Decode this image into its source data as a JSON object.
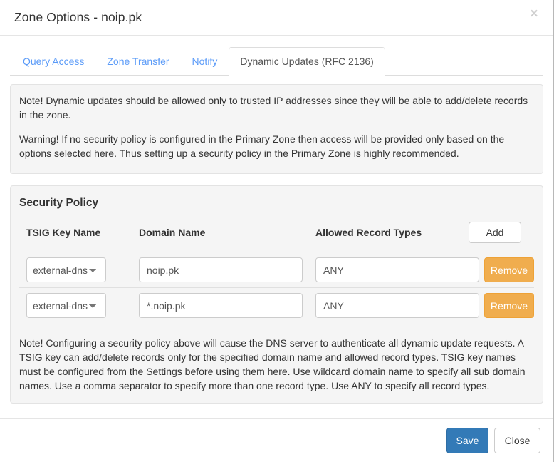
{
  "modal": {
    "title": "Zone Options - noip.pk",
    "close_icon": "close-icon",
    "close_symbol": "×"
  },
  "tabs": [
    {
      "label": "Query Access",
      "active": false
    },
    {
      "label": "Zone Transfer",
      "active": false
    },
    {
      "label": "Notify",
      "active": false
    },
    {
      "label": "Dynamic Updates (RFC 2136)",
      "active": true
    }
  ],
  "notes_top": [
    "Note! Dynamic updates should be allowed only to trusted IP addresses since they will be able to add/delete records in the zone.",
    "Warning! If no security policy is configured in the Primary Zone then access will be provided only based on the options selected here. Thus setting up a security policy in the Primary Zone is highly recommended."
  ],
  "security_policy": {
    "heading": "Security Policy",
    "columns": {
      "tsig_key_name": "TSIG Key Name",
      "domain_name": "Domain Name",
      "allowed_record_types": "Allowed Record Types"
    },
    "add_label": "Add",
    "remove_label": "Remove",
    "rows": [
      {
        "tsig_key": "external-dns",
        "tsig_options": [
          "external-dns"
        ],
        "domain": "noip.pk",
        "domain_placeholder": "",
        "types": "ANY",
        "types_placeholder": "",
        "remove_label": "Remove"
      },
      {
        "tsig_key": "external-dns",
        "tsig_options": [
          "external-dns"
        ],
        "domain": "*.noip.pk",
        "domain_placeholder": "",
        "types": "ANY",
        "types_placeholder": "",
        "remove_label": "Remove"
      }
    ],
    "footer_note": "Note! Configuring a security policy above will cause the DNS server to authenticate all dynamic update requests. A TSIG key can add/delete records only for the specified domain name and allowed record types. TSIG key names must be configured from the Settings before using them here. Use wildcard domain name to specify all sub domain names. Use a comma separator to specify more than one record type. Use ANY to specify all record types."
  },
  "footer": {
    "save_label": "Save",
    "close_label": "Close"
  },
  "colors": {
    "accent_primary": "#337ab7",
    "warning": "#f0ad4e",
    "link": "#5b9bf8",
    "panel_bg": "#f5f5f5",
    "panel_border": "#e3e3e3"
  }
}
